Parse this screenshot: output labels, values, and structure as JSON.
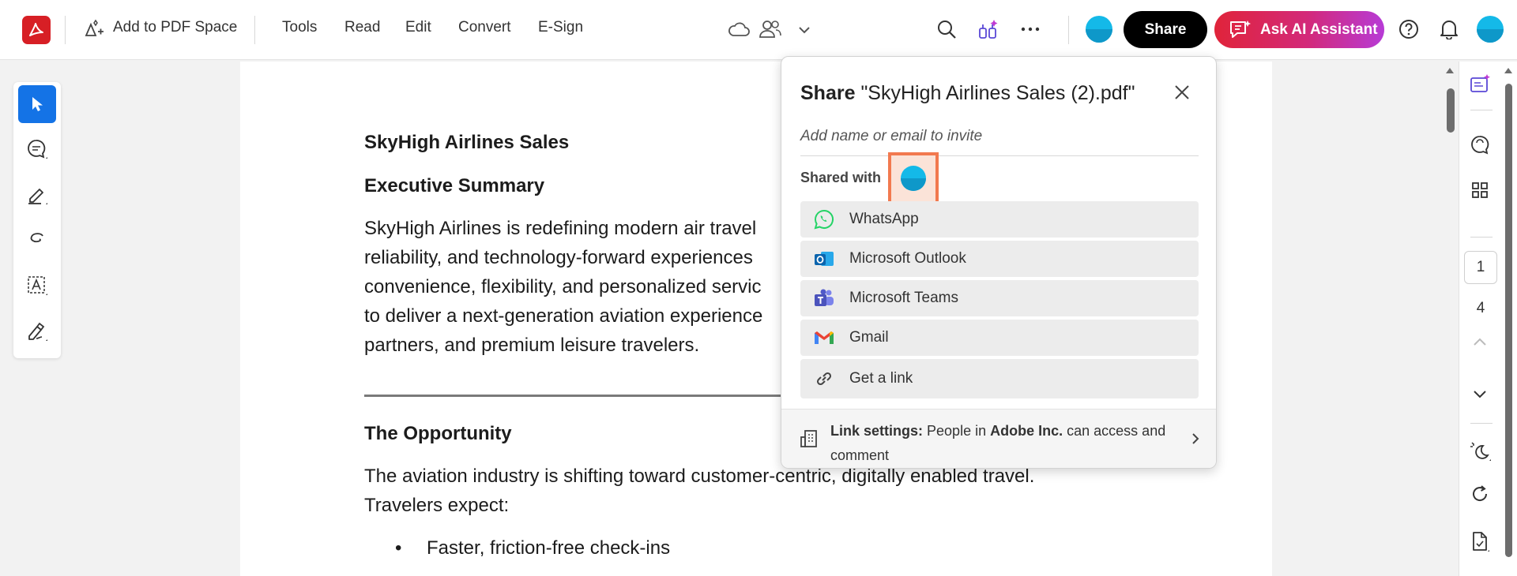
{
  "toolbar": {
    "add_to_space": "Add to PDF Space",
    "menus": [
      "Tools",
      "Read",
      "Edit",
      "Convert",
      "E-Sign"
    ],
    "share_label": "Share",
    "ai_label": "Ask AI Assistant"
  },
  "document": {
    "title": "SkyHigh Airlines Sales",
    "section1": "Executive Summary",
    "para1_lines": [
      "SkyHigh Airlines is redefining modern air travel",
      "reliability, and technology-forward experiences",
      "convenience, flexibility, and personalized servic",
      "to deliver a next-generation aviation experience",
      "partners, and premium leisure travelers."
    ],
    "section2": "The Opportunity",
    "para2_lines": [
      "The aviation industry is shifting toward customer-centric, digitally enabled travel.",
      "Travelers expect:"
    ],
    "bullets": [
      "Faster, friction-free check-ins"
    ]
  },
  "share_dialog": {
    "title_bold": "Share",
    "title_file": "\"SkyHigh Airlines Sales (2).pdf\"",
    "invite_placeholder": "Add name or email to invite",
    "shared_with_label": "Shared with",
    "options": [
      "WhatsApp",
      "Microsoft Outlook",
      "Microsoft Teams",
      "Gmail",
      "Get a link"
    ],
    "link_settings_label": "Link settings:",
    "link_settings_text_1": "People in",
    "link_settings_org": "Adobe Inc.",
    "link_settings_text_2": "can access and comment"
  },
  "right_panel": {
    "current_page": "1",
    "total_pages": "4"
  },
  "colors": {
    "accent_blue": "#1473e6",
    "adobe_red": "#d71f25",
    "highlight_orange": "#f2794f"
  }
}
